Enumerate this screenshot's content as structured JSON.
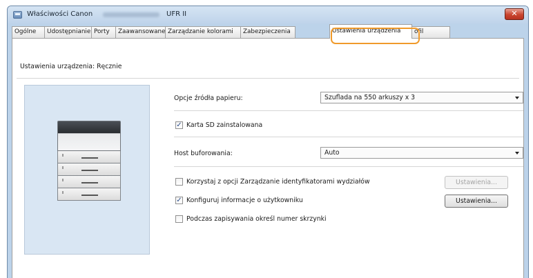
{
  "window": {
    "title_prefix": "Właściwości Canon",
    "title_model": "UFR II",
    "close_glyph": "✕"
  },
  "tabs": [
    {
      "label": "Ogólne"
    },
    {
      "label": "Udostępnianie"
    },
    {
      "label": "Porty"
    },
    {
      "label": "Zaawansowane"
    },
    {
      "label": "Zarządzanie kolorami"
    },
    {
      "label": "Zabezpieczenia"
    },
    {
      "label": "Ustawienia urządzenia"
    },
    {
      "label": "ofil"
    }
  ],
  "active_tab": "Ustawienia urządzenia",
  "highlight_color": "#f09a2a",
  "device": {
    "mode_label": "Ustawienia urządzenia: Ręcznie",
    "paper_source_label": "Opcje źródła papieru:",
    "paper_source_value": "Szuflada na 550 arkuszy x 3",
    "sd_card_label": "Karta SD zainstalowana",
    "sd_card_checked": true,
    "spool_host_label": "Host buforowania:",
    "spool_host_value": "Auto",
    "dept_id_label": "Korzystaj z opcji Zarządzanie identyfikatorami wydziałów",
    "dept_id_checked": false,
    "dept_id_button": "Ustawienia...",
    "user_info_label": "Konfiguruj informacje o użytkowniku",
    "user_info_checked": true,
    "user_info_button": "Ustawienia...",
    "mailbox_label": "Podczas zapisywania określ numer skrzynki",
    "mailbox_checked": false,
    "check_glyph": "✓"
  }
}
